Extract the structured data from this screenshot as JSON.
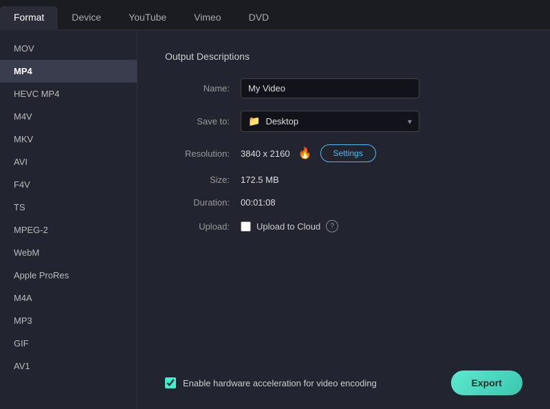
{
  "topNav": {
    "tabs": [
      {
        "id": "format",
        "label": "Format",
        "active": true
      },
      {
        "id": "device",
        "label": "Device",
        "active": false
      },
      {
        "id": "youtube",
        "label": "YouTube",
        "active": false
      },
      {
        "id": "vimeo",
        "label": "Vimeo",
        "active": false
      },
      {
        "id": "dvd",
        "label": "DVD",
        "active": false
      }
    ]
  },
  "sidebar": {
    "items": [
      {
        "id": "mov",
        "label": "MOV",
        "active": false
      },
      {
        "id": "mp4",
        "label": "MP4",
        "active": true
      },
      {
        "id": "hevc-mp4",
        "label": "HEVC MP4",
        "active": false
      },
      {
        "id": "m4v",
        "label": "M4V",
        "active": false
      },
      {
        "id": "mkv",
        "label": "MKV",
        "active": false
      },
      {
        "id": "avi",
        "label": "AVI",
        "active": false
      },
      {
        "id": "f4v",
        "label": "F4V",
        "active": false
      },
      {
        "id": "ts",
        "label": "TS",
        "active": false
      },
      {
        "id": "mpeg2",
        "label": "MPEG-2",
        "active": false
      },
      {
        "id": "webm",
        "label": "WebM",
        "active": false
      },
      {
        "id": "apple-prores",
        "label": "Apple ProRes",
        "active": false
      },
      {
        "id": "m4a",
        "label": "M4A",
        "active": false
      },
      {
        "id": "mp3",
        "label": "MP3",
        "active": false
      },
      {
        "id": "gif",
        "label": "GIF",
        "active": false
      },
      {
        "id": "av1",
        "label": "AV1",
        "active": false
      }
    ]
  },
  "content": {
    "section_title": "Output Descriptions",
    "name_label": "Name:",
    "name_value": "My Video",
    "name_placeholder": "My Video",
    "save_to_label": "Save to:",
    "save_to_value": "Desktop",
    "resolution_label": "Resolution:",
    "resolution_value": "3840 x 2160",
    "fire_icon": "🔥",
    "settings_label": "Settings",
    "size_label": "Size:",
    "size_value": "172.5 MB",
    "duration_label": "Duration:",
    "duration_value": "00:01:08",
    "upload_label": "Upload:",
    "upload_to_cloud_label": "Upload to Cloud",
    "help_icon": "?",
    "hw_accel_label": "Enable hardware acceleration for video encoding",
    "export_label": "Export"
  }
}
